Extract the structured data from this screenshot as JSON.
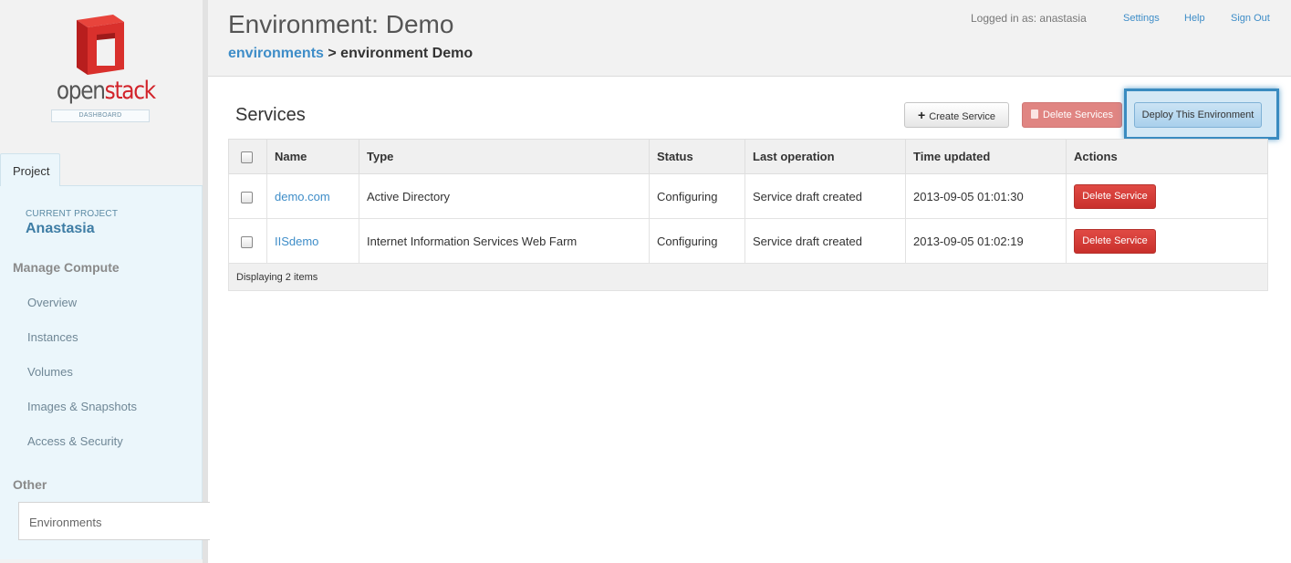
{
  "logo": {
    "word_a": "open",
    "word_b": "stack",
    "sub": "DASHBOARD",
    "colors": {
      "brand_red": "#d2232a"
    }
  },
  "sidebar": {
    "tab": "Project",
    "current_project_label": "CURRENT PROJECT",
    "current_project_name": "Anastasia",
    "section_compute": "Manage Compute",
    "items": [
      "Overview",
      "Instances",
      "Volumes",
      "Images & Snapshots",
      "Access & Security"
    ],
    "section_other": "Other",
    "active_item": "Environments"
  },
  "header": {
    "title": "Environment: Demo",
    "breadcrumb_link": "environments",
    "breadcrumb_sep": ">",
    "breadcrumb_current": "environment Demo",
    "logged_in": "Logged in as: anastasia",
    "links": [
      "Settings",
      "Help",
      "Sign Out"
    ]
  },
  "services": {
    "title": "Services",
    "create_label": "Create Service",
    "delete_all_label": "Delete Services",
    "deploy_label": "Deploy This Environment",
    "columns": [
      "Name",
      "Type",
      "Status",
      "Last operation",
      "Time updated",
      "Actions"
    ],
    "rows": [
      {
        "name": "demo.com",
        "type": "Active Directory",
        "status": "Configuring",
        "last_op": "Service draft created",
        "time": "2013-09-05 01:01:30",
        "action": "Delete Service"
      },
      {
        "name": "IISdemo",
        "type": "Internet Information Services Web Farm",
        "status": "Configuring",
        "last_op": "Service draft created",
        "time": "2013-09-05 01:02:19",
        "action": "Delete Service"
      }
    ],
    "footer": "Displaying 2 items"
  }
}
